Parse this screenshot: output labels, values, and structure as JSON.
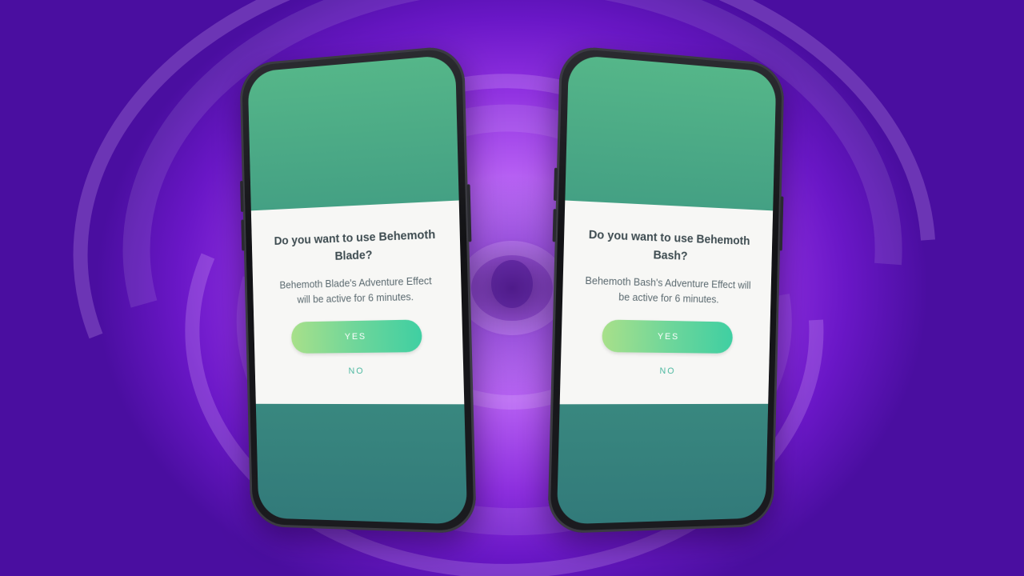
{
  "colors": {
    "background": "#8e2fe0",
    "screen_green": "#3f9a82",
    "dialog_bg": "#f7f7f5",
    "yes_gradient_start": "#a8e08a",
    "yes_gradient_end": "#3fcfa2",
    "no_text": "#4db8a0"
  },
  "phones": [
    {
      "dialog": {
        "title": "Do you want to use Behemoth Blade?",
        "body": "Behemoth Blade's Adventure Effect will be active for 6 minutes.",
        "yes_label": "YES",
        "no_label": "NO"
      }
    },
    {
      "dialog": {
        "title": "Do you want to use Behemoth Bash?",
        "body": "Behemoth Bash's Adventure Effect will be active for 6 minutes.",
        "yes_label": "YES",
        "no_label": "NO"
      }
    }
  ]
}
